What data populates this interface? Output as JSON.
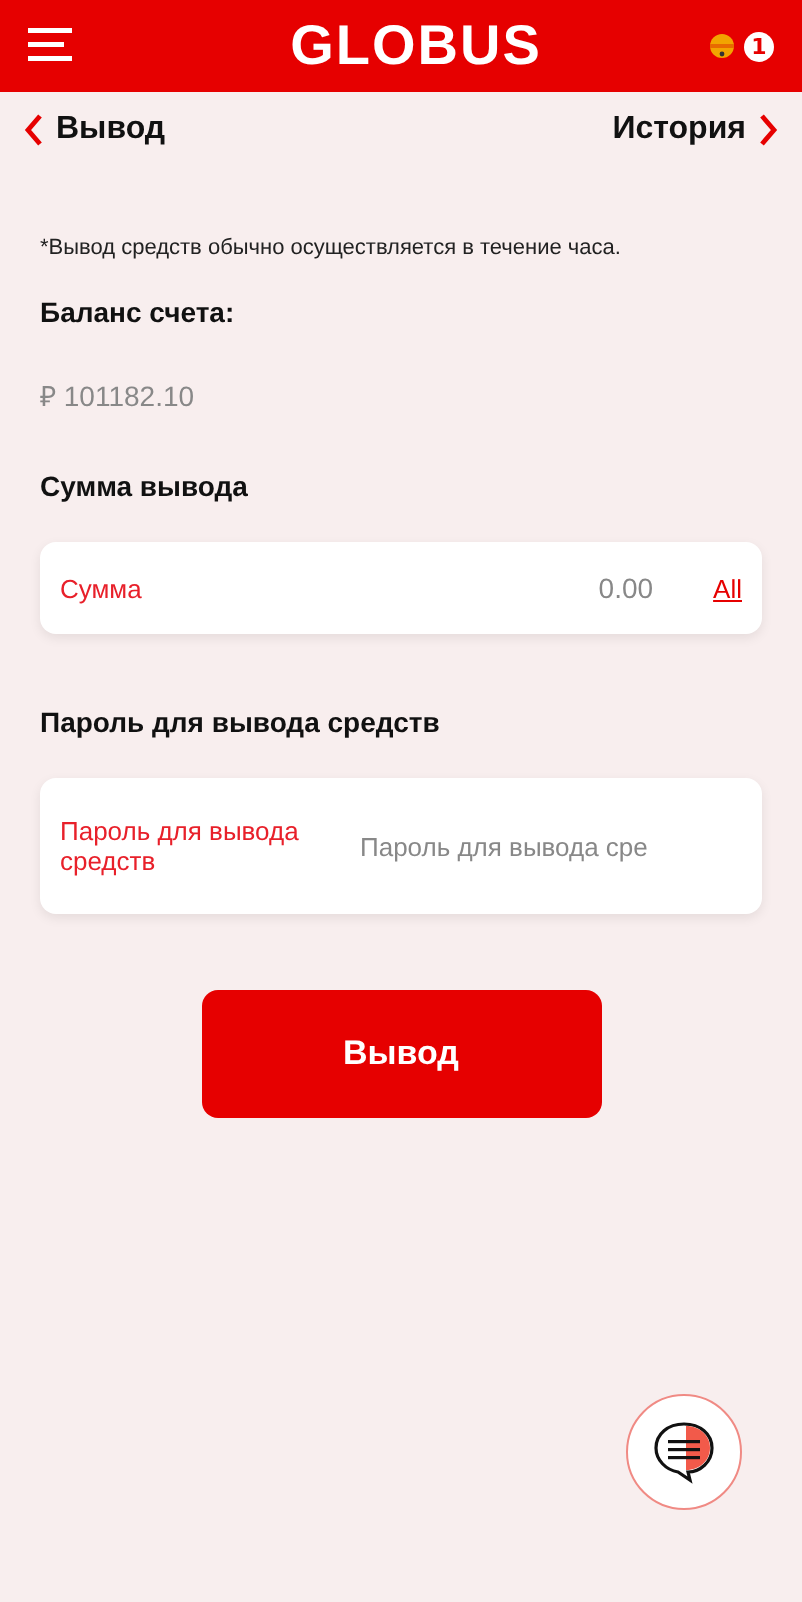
{
  "header": {
    "logo": "GLOBUS",
    "notification_count": "1"
  },
  "nav": {
    "back": "Вывод",
    "history": "История"
  },
  "notice": "*Вывод средств обычно осуществляется в течение часа.",
  "balance": {
    "label": "Баланс счета:",
    "value": "₽ 101182.10"
  },
  "amount": {
    "heading": "Сумма вывода",
    "label": "Сумма",
    "placeholder": "0.00",
    "all_link": "All"
  },
  "password": {
    "heading": "Пароль для вывода средств",
    "label": "Пароль для вывода средств",
    "placeholder": "Пароль для вывода сре"
  },
  "submit": "Вывод"
}
